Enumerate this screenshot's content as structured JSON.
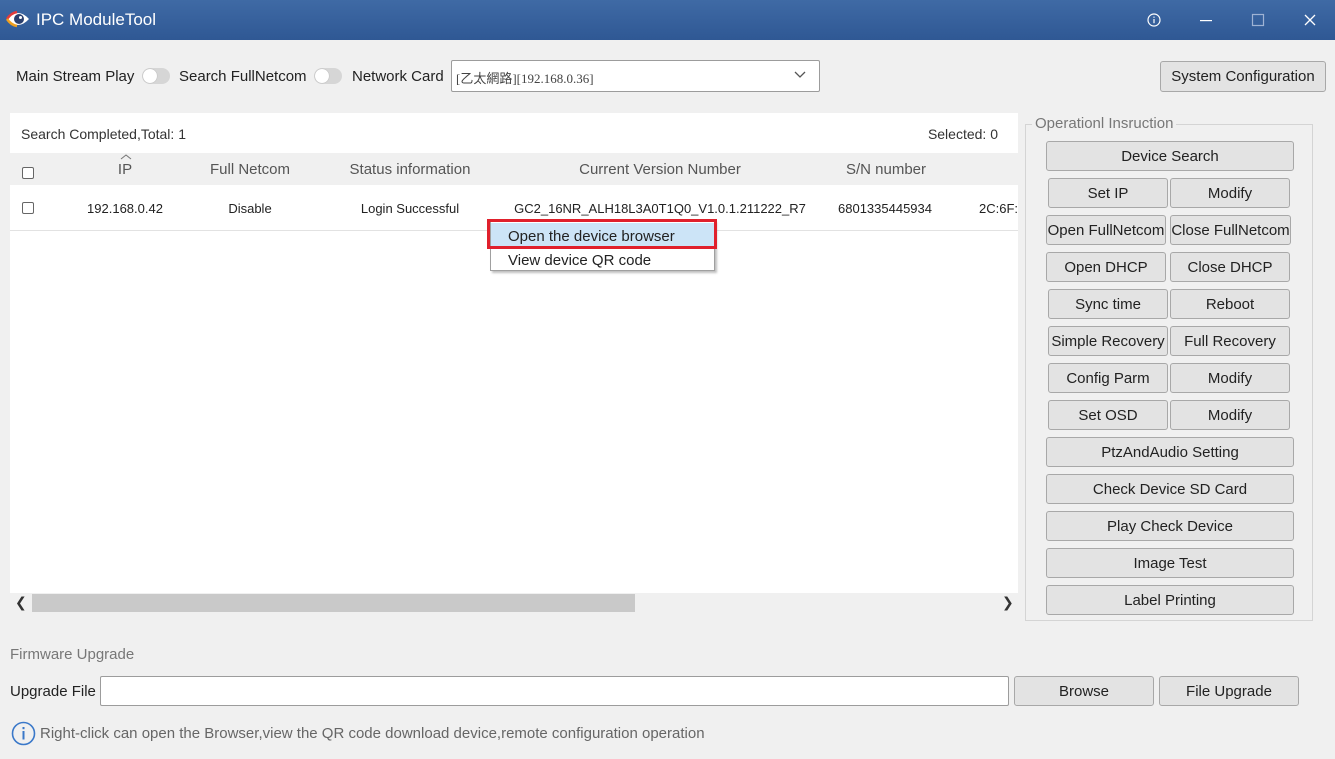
{
  "window": {
    "title": "IPC ModuleTool",
    "controls": [
      "info-icon",
      "minimize-icon",
      "maximize-icon",
      "close-icon"
    ]
  },
  "toolbar": {
    "main_stream_label": "Main Stream Play",
    "main_stream_on": false,
    "search_fullnetcom_label": "Search FullNetcom",
    "search_fullnetcom_on": false,
    "network_card_label": "Network Card",
    "network_card_value": "[乙太網路][192.168.0.36]",
    "system_config_label": "System Configuration"
  },
  "search": {
    "status": "Search Completed,Total:  1",
    "selected": "Selected: 0"
  },
  "table": {
    "columns": [
      "IP",
      "Full Netcom",
      "Status information",
      "Current Version Number",
      "S/N number"
    ],
    "rows": [
      {
        "ip": "192.168.0.42",
        "full_netcom": "Disable",
        "status": "Login Successful",
        "version": "GC2_16NR_ALH18L3A0T1Q0_V1.0.1.211222_R7",
        "sn": "6801335445934",
        "mac": "2C:6F:"
      }
    ]
  },
  "context_menu": {
    "items": [
      "Open the device browser",
      "View device QR code"
    ],
    "highlighted_index": 0
  },
  "operations": {
    "title": "Operationl Insruction",
    "device_search": "Device Search",
    "set_ip": "Set IP",
    "modify_ip": "Modify",
    "open_fullnetcom": "Open FullNetcom",
    "close_fullnetcom": "Close FullNetcom",
    "open_dhcp": "Open DHCP",
    "close_dhcp": "Close DHCP",
    "sync_time": "Sync time",
    "reboot": "Reboot",
    "simple_recovery": "Simple Recovery",
    "full_recovery": "Full Recovery",
    "config_parm": "Config Parm",
    "modify_config": "Modify",
    "set_osd": "Set OSD",
    "modify_osd": "Modify",
    "ptz_audio": "PtzAndAudio Setting",
    "check_sd": "Check Device SD Card",
    "play_check": "Play Check Device",
    "image_test": "Image Test",
    "label_printing": "Label Printing"
  },
  "firmware": {
    "section_title": "Firmware Upgrade",
    "upgrade_file_label": "Upgrade File",
    "upgrade_file_value": "",
    "browse_label": "Browse",
    "file_upgrade_label": "File Upgrade"
  },
  "hint": {
    "text": "Right-click can open the Browser,view the QR code download device,remote configuration operation"
  },
  "colors": {
    "titlebar": "#2f5894",
    "highlight_border": "#e0202c",
    "menu_selection": "#cce4f7"
  }
}
